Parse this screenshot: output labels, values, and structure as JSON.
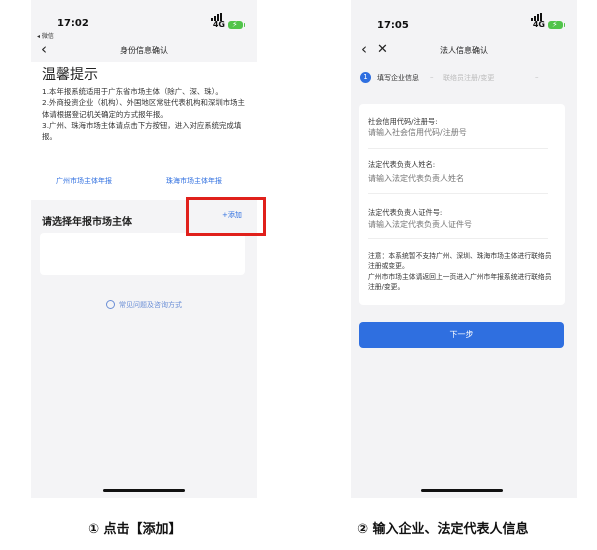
{
  "left_phone": {
    "status": {
      "time": "17:02",
      "back_app": "◂ 微信",
      "network": "4G"
    },
    "nav_title": "身份信息确认",
    "tip_title": "温馨提示",
    "tip_lines": [
      "1.本年报系统适用于广东省市场主体（除广、深、珠）。",
      "2.外商投资企业（机构）、外国地区常驻代表机构和深圳市场主体请根据登记机关确定的方式报年报。",
      "3.广州、珠海市场主体请点击下方按钮，进入对应系统完成填报。"
    ],
    "link_guangzhou": "广州市场主体年报",
    "link_zhuhai": "珠海市场主体年报",
    "select_title": "请选择年报市场主体",
    "add_label": "+添加",
    "faq_label": "常见问题及咨询方式"
  },
  "right_phone": {
    "status": {
      "time": "17:05",
      "network": "4G"
    },
    "nav_title": "法人信息确认",
    "step1_num": "1",
    "step1_label": "填写企业信息",
    "step2_label": "联络员注册/变更",
    "fields": [
      {
        "label": "社会信用代码/注册号:",
        "placeholder": "请输入社会信用代码/注册号"
      },
      {
        "label": "法定代表负责人姓名:",
        "placeholder": "请输入法定代表负责人姓名"
      },
      {
        "label": "法定代表负责人证件号:",
        "placeholder": "请输入法定代表负责人证件号"
      }
    ],
    "notice_lines": [
      "注意：本系统暂不支持广州、深圳、珠海市场主体进行联络员注册或变更。",
      "广州市市场主体请返回上一页进入广州市年报系统进行联络员注册/变更。"
    ],
    "next_label": "下一步"
  },
  "captions": {
    "left": "① 点击【添加】",
    "right": "② 输入企业、法定代表人信息"
  },
  "colors": {
    "accent": "#2f6fe0",
    "highlight": "#e0201b",
    "battery": "#51c44a"
  }
}
